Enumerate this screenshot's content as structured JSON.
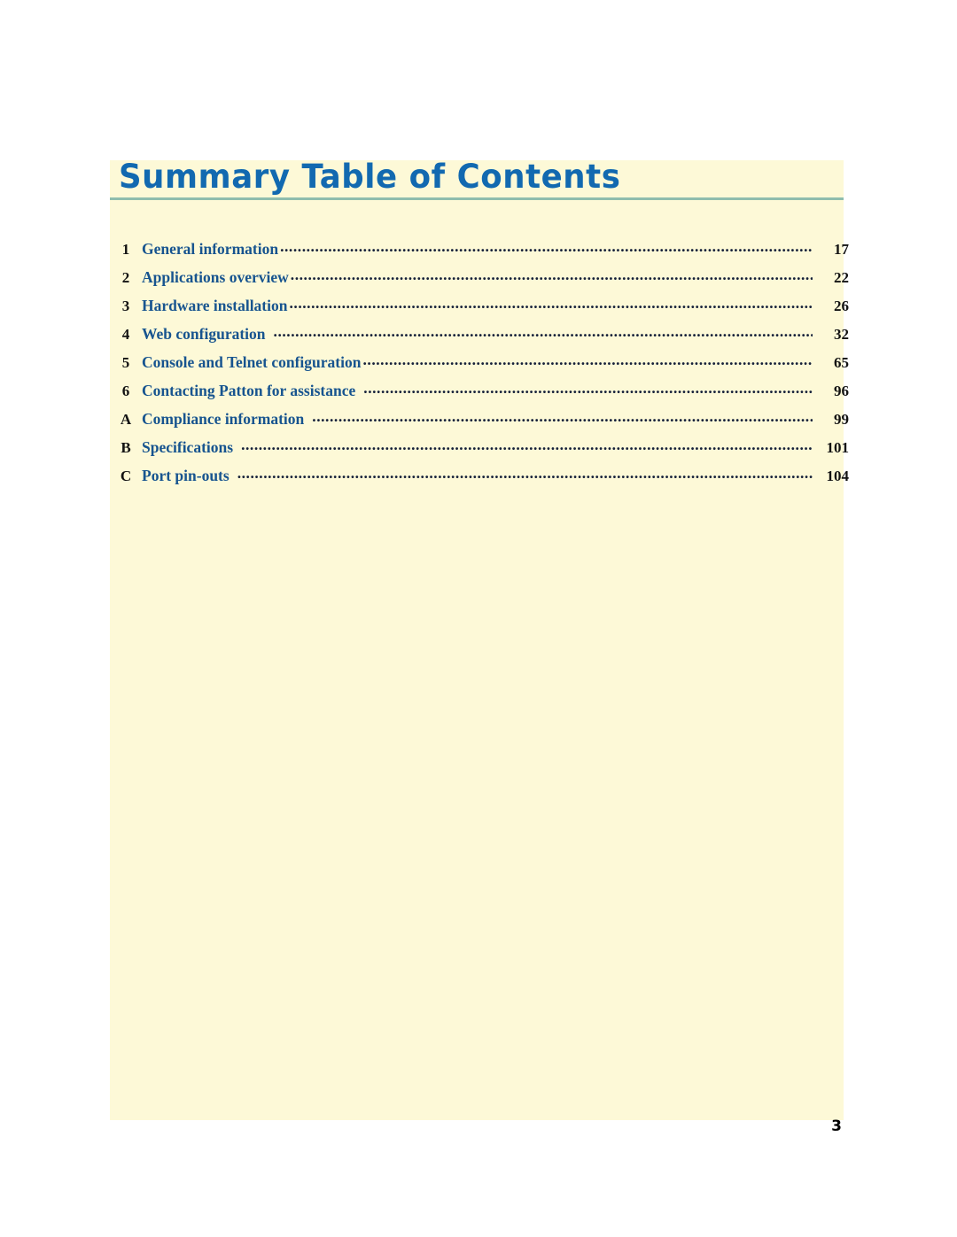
{
  "document": {
    "title": "Summary Table of Contents",
    "footer_page_number": "3"
  },
  "colors": {
    "panel_background": "#fdf9d7",
    "page_background": "#ffffff",
    "title_blue": "#1269b0",
    "entry_blue": "#17548f",
    "rule_green": "#8fbdad",
    "number_black": "#121212"
  },
  "toc": {
    "entries": [
      {
        "number": "1",
        "label": "General information",
        "page": "17"
      },
      {
        "number": "2",
        "label": "Applications overview",
        "page": "22"
      },
      {
        "number": "3",
        "label": "Hardware installation",
        "page": "26"
      },
      {
        "number": "4",
        "label": "Web configuration",
        "page": "32"
      },
      {
        "number": "5",
        "label": "Console and Telnet configuration",
        "page": "65"
      },
      {
        "number": "6",
        "label": "Contacting Patton for assistance",
        "page": "96"
      },
      {
        "number": "A",
        "label": "Compliance information",
        "page": "99"
      },
      {
        "number": "B",
        "label": "Specifications",
        "page": "101"
      },
      {
        "number": "C",
        "label": "Port pin-outs",
        "page": "104"
      }
    ]
  }
}
